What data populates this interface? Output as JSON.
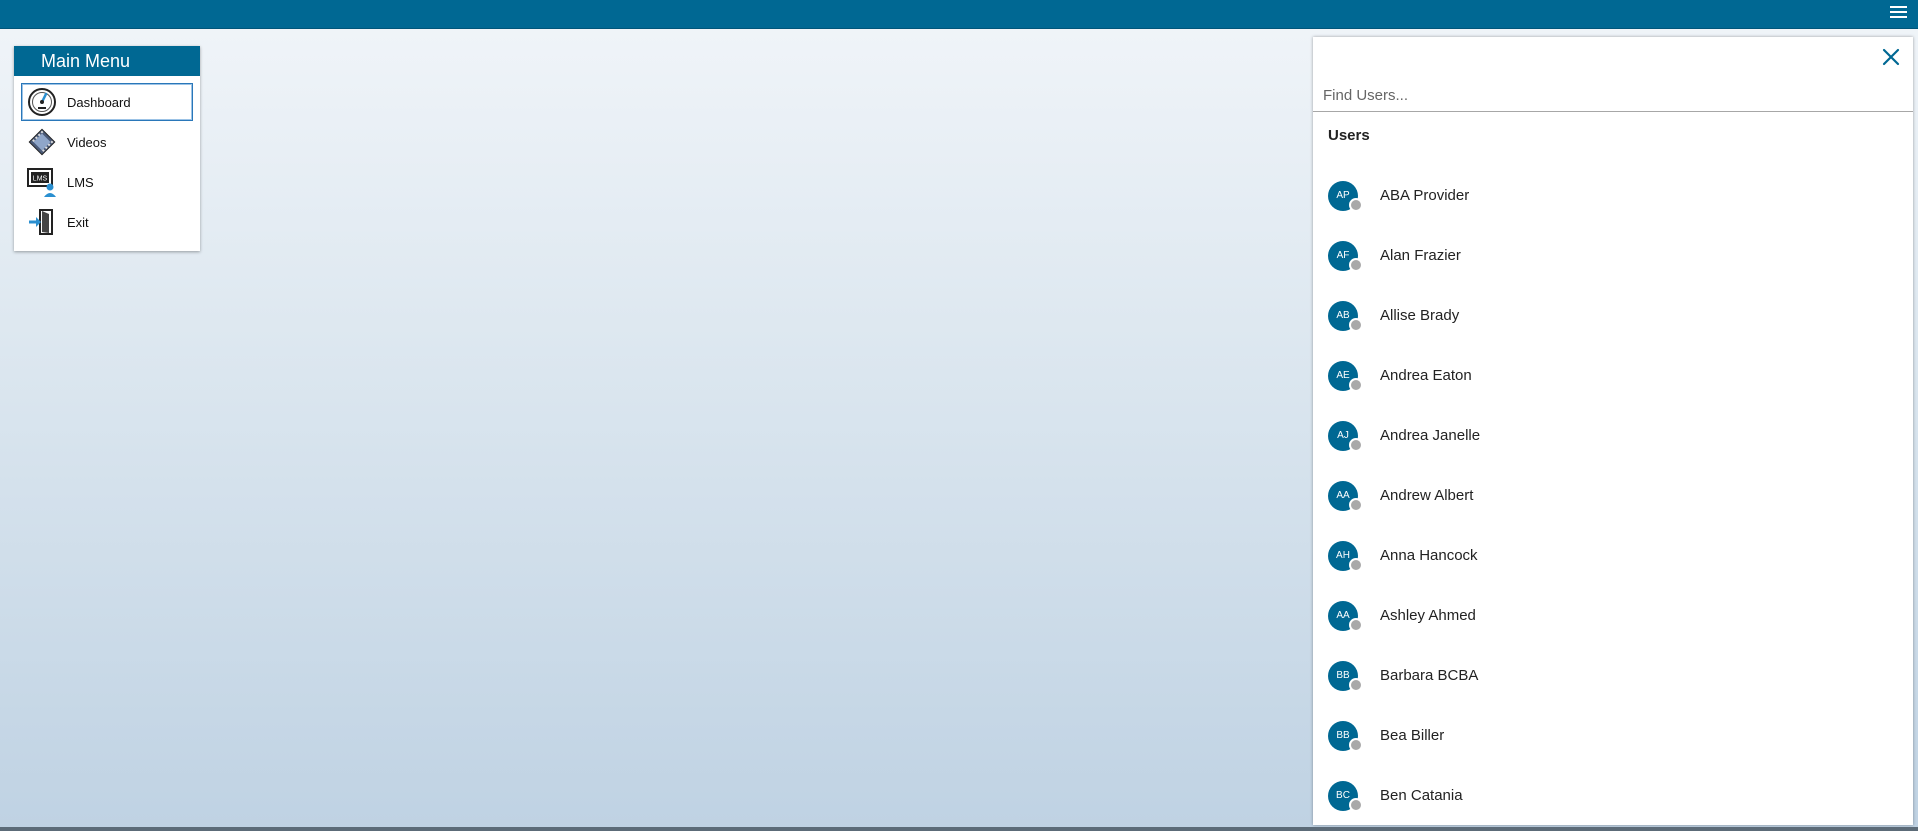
{
  "topbar": {
    "menu_icon": "hamburger-icon",
    "color": "#006893"
  },
  "main_menu": {
    "title": "Main Menu",
    "items": [
      {
        "label": "Dashboard",
        "icon": "speedometer-icon",
        "active": true
      },
      {
        "label": "Videos",
        "icon": "film-icon",
        "active": false
      },
      {
        "label": "LMS",
        "icon": "lms-user-icon",
        "active": false
      },
      {
        "label": "Exit",
        "icon": "exit-door-icon",
        "active": false
      }
    ]
  },
  "users_panel": {
    "close_icon": "close-icon",
    "search": {
      "placeholder": "Find Users...",
      "value": ""
    },
    "section_title": "Users",
    "users": [
      {
        "initials": "AP",
        "name": "ABA Provider"
      },
      {
        "initials": "AF",
        "name": "Alan Frazier"
      },
      {
        "initials": "AB",
        "name": "Allise Brady"
      },
      {
        "initials": "AE",
        "name": "Andrea Eaton"
      },
      {
        "initials": "AJ",
        "name": "Andrea Janelle"
      },
      {
        "initials": "AA",
        "name": "Andrew Albert"
      },
      {
        "initials": "AH",
        "name": "Anna Hancock"
      },
      {
        "initials": "AA",
        "name": "Ashley Ahmed"
      },
      {
        "initials": "BB",
        "name": "Barbara BCBA"
      },
      {
        "initials": "BB",
        "name": "Bea Biller"
      },
      {
        "initials": "BC",
        "name": "Ben Catania"
      }
    ]
  }
}
